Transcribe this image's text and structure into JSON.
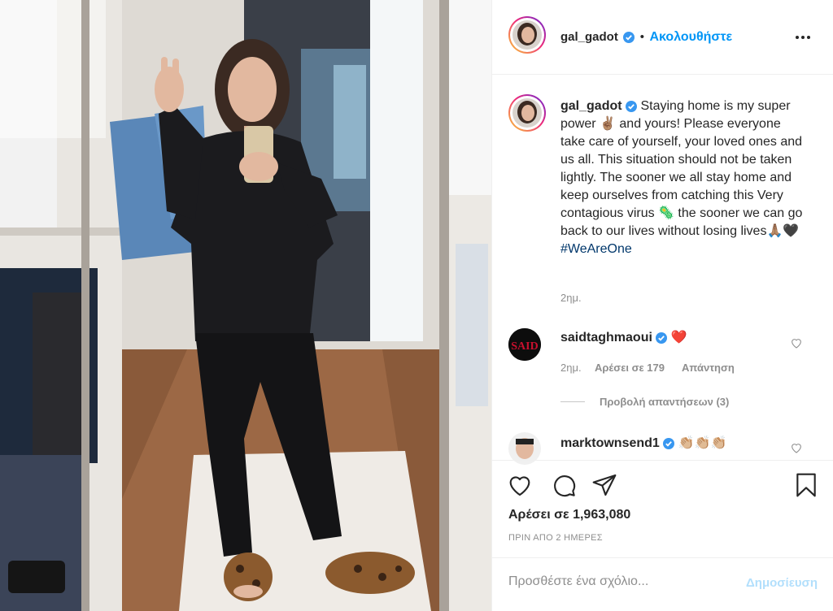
{
  "post": {
    "author": "gal_gadot",
    "follow_label": "Ακολουθήστε",
    "more_icon": "more-horizontal-icon",
    "caption_text": "Staying home is my super power ✌🏽 and yours! Please everyone take care of yourself, your loved ones and us all. This situation should not be taken lightly. The sooner we all stay home and keep ourselves from catching this Very contagious virus 🦠 the sooner we can go back to our lives without losing lives🙏🏽🖤",
    "hashtag": "#WeAreOne",
    "caption_time": "2ημ.",
    "likes_label": "Αρέσει σε 1,963,080",
    "date_label": "ΠΡΙΝ ΑΠΟ 2 ΗΜΕΡΕΣ",
    "add_comment_placeholder": "Προσθέστε ένα σχόλιο...",
    "publish_label": "Δημοσίευση"
  },
  "comments": [
    {
      "user": "saidtaghmaoui",
      "text": "❤️",
      "time": "2ημ.",
      "likes": "Αρέσει σε 179",
      "reply": "Απάντηση",
      "view_replies": "Προβολή απαντήσεων (3)"
    },
    {
      "user": "marktownsend1",
      "text": "👏🏼👏🏼👏🏼"
    }
  ],
  "colors": {
    "accent_blue": "#0095f6",
    "publish_disabled": "#b2dffc",
    "heart_red": "#ed4956",
    "verified_blue": "#3897f0"
  },
  "icons": {
    "like": "heart-icon",
    "comment": "comment-icon",
    "share": "send-icon",
    "save": "bookmark-icon",
    "verified": "verified-badge-icon"
  }
}
